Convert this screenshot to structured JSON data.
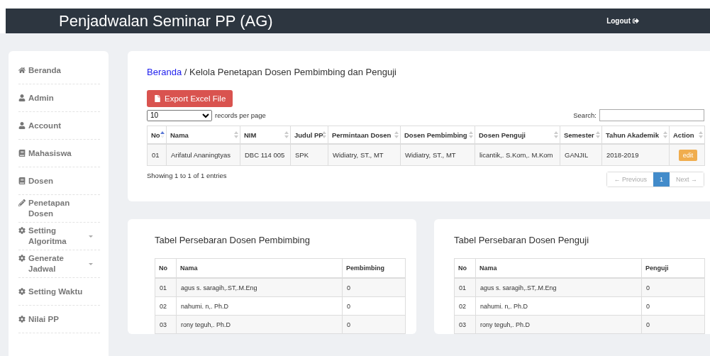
{
  "header": {
    "title": "Penjadwalan Seminar PP (AG)",
    "logout": "Logout"
  },
  "sidebar": {
    "items": [
      {
        "label": "Beranda",
        "submenu": false
      },
      {
        "label": "Admin",
        "submenu": false
      },
      {
        "label": "Account",
        "submenu": false
      },
      {
        "label": "Mahasiswa",
        "submenu": false
      },
      {
        "label": "Dosen",
        "submenu": false
      },
      {
        "label": "Penetapan Dosen",
        "submenu": false
      },
      {
        "label": "Setting Algoritma",
        "submenu": true
      },
      {
        "label": "Generate Jadwal",
        "submenu": true
      },
      {
        "label": "Setting Waktu",
        "submenu": false
      },
      {
        "label": "Nilai PP",
        "submenu": false
      }
    ]
  },
  "breadcrumb": {
    "link": "Beranda",
    "current": " / Kelola Penetapan Dosen Pembimbing dan Penguji"
  },
  "export_button": "Export Excel File",
  "length_select": {
    "value": "10",
    "label": "records per page"
  },
  "search": {
    "label": "Search:"
  },
  "table": {
    "columns": [
      {
        "label": "No",
        "sorted": true
      },
      {
        "label": "Nama",
        "sorted": false
      },
      {
        "label": "NIM",
        "sorted": false
      },
      {
        "label": "Judul PP",
        "sorted": false
      },
      {
        "label": "Permintaan Dosen",
        "sorted": false
      },
      {
        "label": "Dosen Pembimbing",
        "sorted": false
      },
      {
        "label": "Dosen Penguji",
        "sorted": false
      },
      {
        "label": "Semester",
        "sorted": false
      },
      {
        "label": "Tahun Akademik",
        "sorted": false
      },
      {
        "label": "Action",
        "sorted": false
      }
    ],
    "rows": [
      {
        "cells": [
          "01",
          "Arifatul Ananingtyas",
          "DBC 114 005",
          "SPK",
          "Widiatry, ST., MT",
          "Widiatry, ST., MT",
          "licantik,. S.Kom,. M.Kom",
          "GANJIL",
          "2018-2019"
        ],
        "action": "edit"
      }
    ]
  },
  "info": "Showing 1 to 1 of 1 entries",
  "pagination": {
    "previous": {
      "label": "← Previous",
      "disabled": true
    },
    "pages": [
      {
        "label": "1",
        "selected": true
      }
    ],
    "next": {
      "label": "Next →",
      "disabled": true
    }
  },
  "panels": [
    {
      "title": "Tabel Persebaran Dosen Pembimbing",
      "columns": [
        "No",
        "Nama",
        "Pembimbing"
      ],
      "rows": [
        [
          "01",
          "agus s. saragih,.ST,.M.Eng",
          "0"
        ],
        [
          "02",
          "nahumi. n,. Ph.D",
          "0"
        ],
        [
          "03",
          "rony teguh,. Ph.D",
          "0"
        ]
      ]
    },
    {
      "title": "Tabel Persebaran Dosen Penguji",
      "columns": [
        "No",
        "Nama",
        "Penguji"
      ],
      "rows": [
        [
          "01",
          "agus s. saragih,.ST,.M.Eng",
          "0"
        ],
        [
          "02",
          "nahumi. n,. Ph.D",
          "0"
        ],
        [
          "03",
          "rony teguh,. Ph.D",
          "0"
        ]
      ]
    }
  ]
}
